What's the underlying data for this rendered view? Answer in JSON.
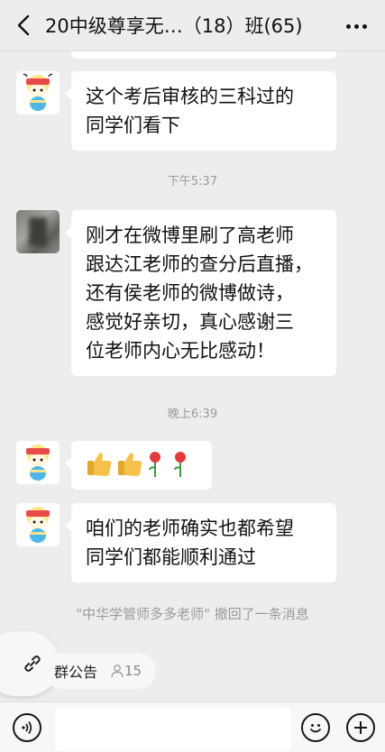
{
  "header": {
    "title": "20中级尊享无…（18）班(65)"
  },
  "messages": [
    {
      "avatar": "cartoon-bee-avatar",
      "lines": [
        "这个考后审核的三科过的",
        "同学们看下"
      ]
    },
    {
      "timestamp": "下午5:37"
    },
    {
      "avatar": "blurred-photo-avatar",
      "lines": [
        "刚才在微博里刷了高老师",
        "跟达江老师的查分后直播，",
        "还有侯老师的微博做诗，",
        "感觉好亲切，真心感谢三",
        "位老师内心无比感动！"
      ]
    },
    {
      "timestamp": "晚上6:39"
    },
    {
      "avatar": "cartoon-bee-avatar",
      "emoji": [
        "thumbs-up",
        "thumbs-up",
        "rose",
        "rose"
      ]
    },
    {
      "avatar": "cartoon-bee-avatar",
      "lines": [
        "咱们的老师确实也都希望",
        "同学们都能顺利通过"
      ]
    }
  ],
  "recall_notice": "\"中华学管师多多老师\" 撤回了一条消息",
  "announcement": {
    "label": "群公告",
    "count": "15"
  },
  "input": {
    "value": ""
  }
}
